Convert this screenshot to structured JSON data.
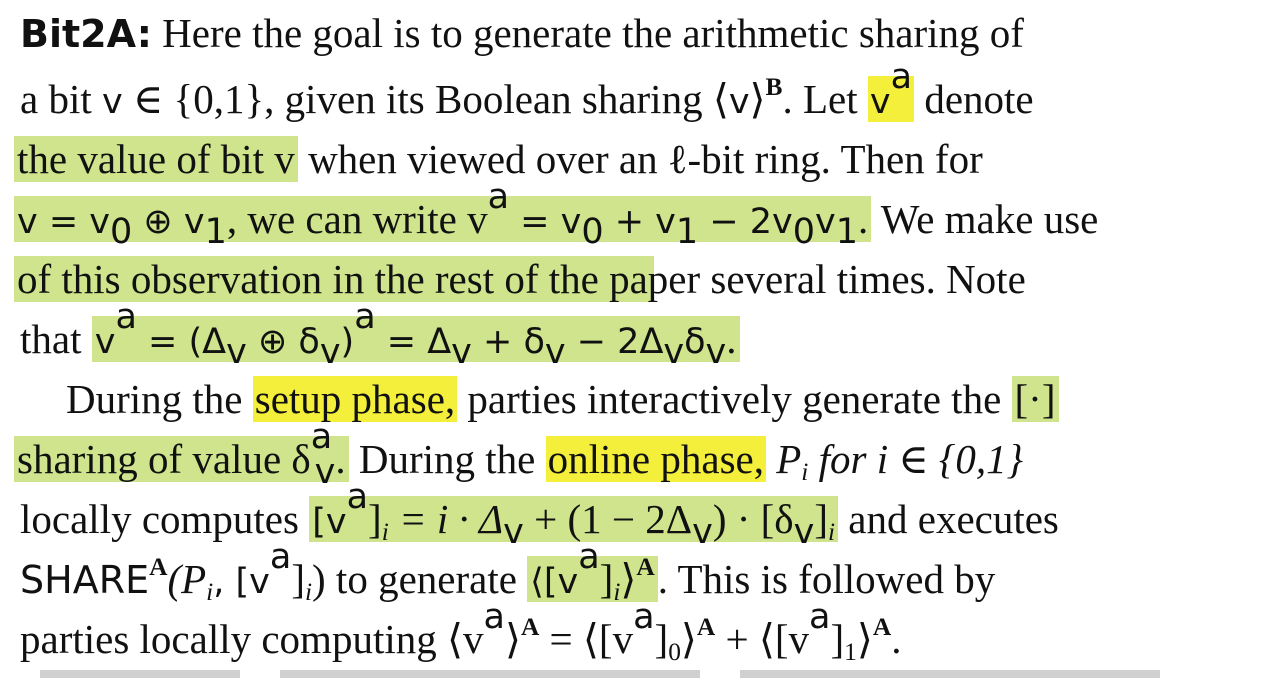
{
  "paragraph1": {
    "heading": "Bit2A:",
    "l1": "Here the goal is to generate the arithmetic sharing of",
    "l2a": "a bit ",
    "l2b": "v",
    "l2c": " ∈ {0,1}, given its Boolean sharing ⟨",
    "l2d": "v",
    "l2e": "⟩",
    "l2f": "B",
    "l2g": ". Let ",
    "l2h": "v",
    "l2i": "a",
    "l2j": " denote",
    "l3a": "the value of bit v",
    "l3b": " when viewed over an ℓ-bit ring. Then for",
    "l4a": "v = v",
    "l4b": "0",
    "l4c": " ⊕ v",
    "l4d": "1",
    "l4e": ", we can write v",
    "l4f": "a",
    "l4g": " = v",
    "l4h": " + v",
    "l4i": " − 2v",
    "l4j": "v",
    "l4k": ".",
    "l4l": " We make use",
    "l5": "of this observation in the rest of the paper several times. Note",
    "l6a": "that ",
    "l6b": "v",
    "l6c": " = (Δ",
    "l6d": " ⊕ δ",
    "l6e": ")",
    "l6f": " = Δ",
    "l6g": " + δ",
    "l6h": " − 2Δ",
    "l6i": "δ",
    "l6j": "."
  },
  "paragraph2": {
    "l7a": "During the ",
    "l7b": "setup phase,",
    "l7c": " parties interactively generate the ",
    "l7d": "[·]",
    "l8a": "sharing of value δ",
    "l8b": ".",
    "l8c": " During the ",
    "l8d": "online phase,",
    "l8e": " P",
    "l8f": "i",
    "l8g": " for i ∈ {0,1}",
    "l9a": "locally computes ",
    "l9b": "[v",
    "l9c": "]",
    "l9d": " = i · Δ",
    "l9e": " + (1 − 2Δ",
    "l9f": ") · [δ",
    "l9g": "]",
    "l9h": " and executes",
    "l10a": "SHARE",
    "l10b": "A",
    "l10c": "(P",
    "l10d": ", [v",
    "l10e": "]",
    "l10f": ") to generate ",
    "l10g": "⟨[v",
    "l10h": "]",
    "l10i": "⟩",
    "l10j": ". This is followed by",
    "l11a": "parties locally computing ⟨v",
    "l11b": "⟩",
    "l11c": " = ⟨[v",
    "l11d": "]",
    "l11e": "⟩",
    "l11f": " + ⟨[v",
    "l11g": "]",
    "l11h": "⟩",
    "l11i": "."
  },
  "symbols": {
    "a": "a",
    "A": "A",
    "v": "v",
    "i": "i",
    "zero": "0",
    "one": "1"
  },
  "colors": {
    "highlight_green": "#cfe48c",
    "highlight_yellow": "#f3ef3a",
    "text": "#111111"
  }
}
